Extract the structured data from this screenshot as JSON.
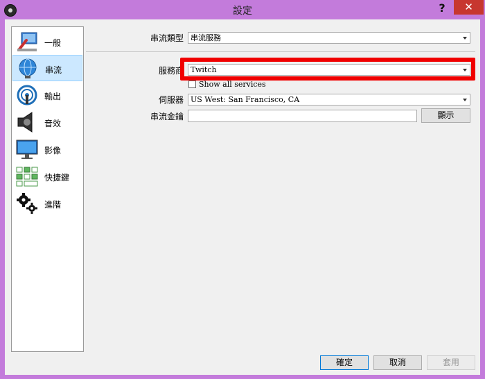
{
  "window": {
    "title": "設定"
  },
  "titlebar": {
    "help_glyph": "?",
    "close_glyph": "✕"
  },
  "sidebar": {
    "items": [
      {
        "label": "一般",
        "icon": "general-settings-icon"
      },
      {
        "label": "串流",
        "icon": "stream-globe-icon",
        "selected": true
      },
      {
        "label": "輸出",
        "icon": "output-icon"
      },
      {
        "label": "音效",
        "icon": "speaker-icon"
      },
      {
        "label": "影像",
        "icon": "monitor-icon"
      },
      {
        "label": "快捷鍵",
        "icon": "hotkeys-icon"
      },
      {
        "label": "進階",
        "icon": "gears-icon"
      }
    ]
  },
  "stream": {
    "type_label": "串流類型",
    "type_value": "串流服務",
    "service_label": "服務商",
    "service_value": "Twitch",
    "show_all_label": "Show all services",
    "server_label": "伺服器",
    "server_value": "US West: San Francisco, CA",
    "key_label": "串流金鑰",
    "key_value": "",
    "show_button": "顯示"
  },
  "footer": {
    "ok": "確定",
    "cancel": "取消",
    "apply": "套用"
  },
  "colors": {
    "highlight": "#f00000",
    "selected_bg": "#cce8ff",
    "frame": "#c37bdb"
  }
}
